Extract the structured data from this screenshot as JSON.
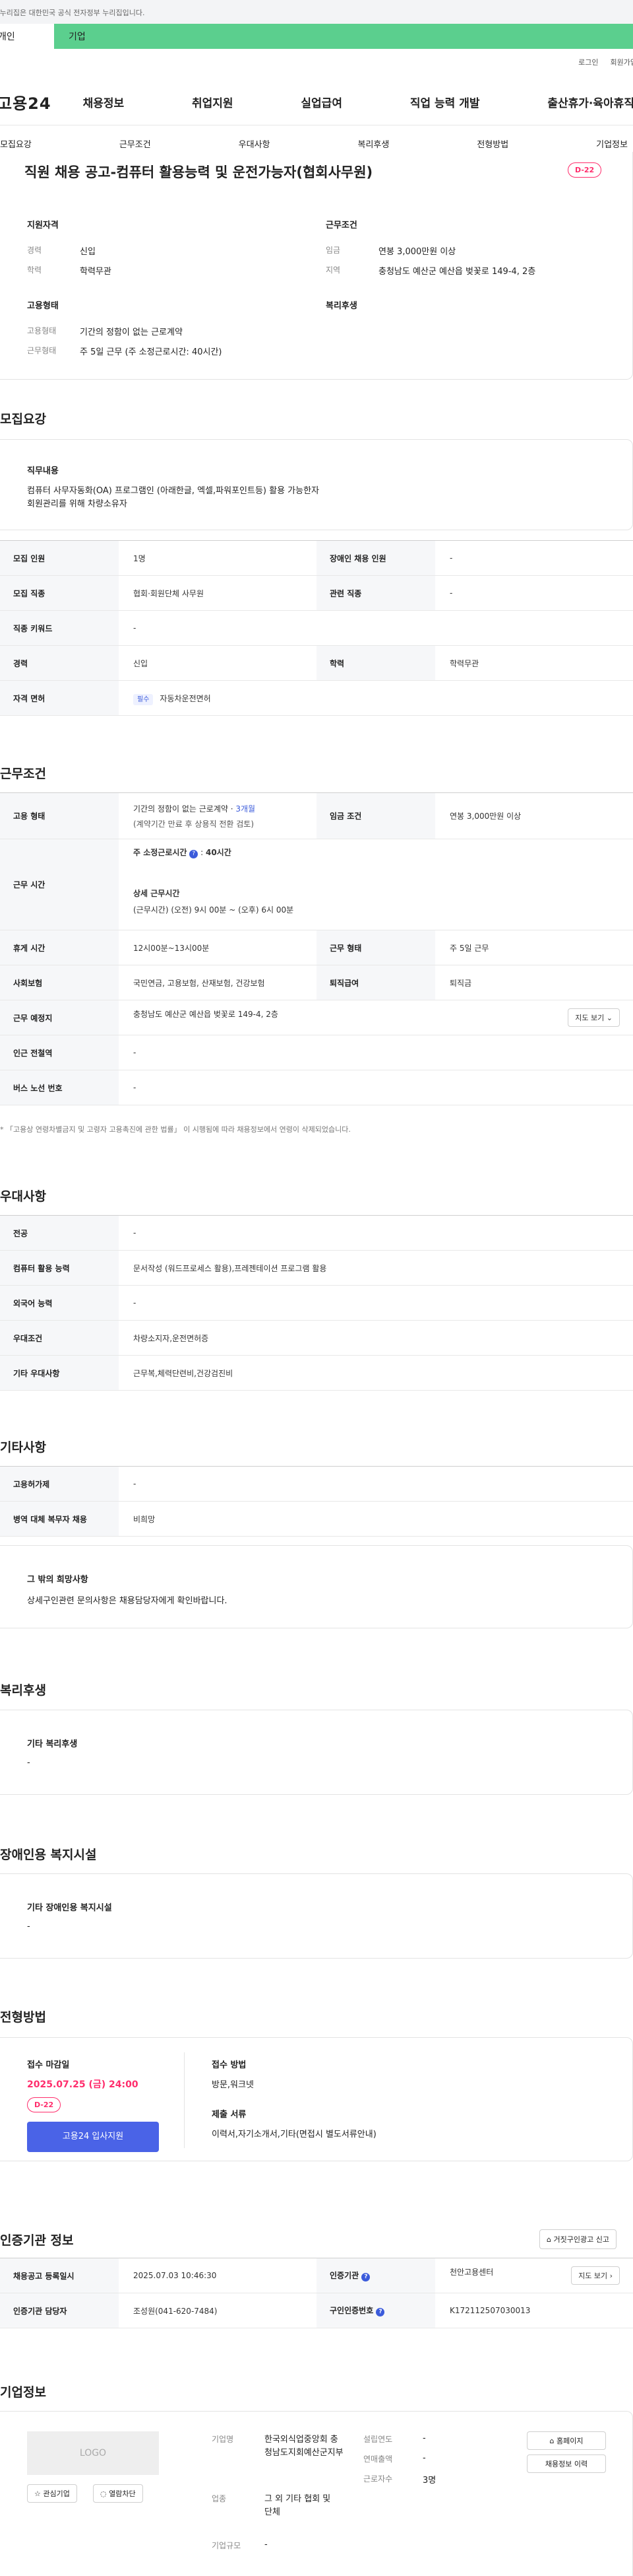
{
  "gov_banner": "이 누리집은 대한민국 공식 전자정부 누리집입니다.",
  "top_tabs": [
    "개인",
    "기업"
  ],
  "util": {
    "login": "로그인",
    "join": "회원가입"
  },
  "logo": "고용24",
  "gnb": [
    "채용정보",
    "취업지원",
    "실업급여",
    "직업 능력 개발",
    "출산휴가·육아휴직"
  ],
  "subtabs": [
    "모집요강",
    "근무조건",
    "우대사항",
    "복리후생",
    "전형방법",
    "기업정보"
  ],
  "summary": {
    "title": "직원 채용 공고-컴퓨터 활용능력 및 운전가능자(협회사무원)",
    "dday": "D-22",
    "qual_head": "지원자격",
    "cond_head": "근무조건",
    "form_head": "고용형태",
    "welfare_head": "복리후생",
    "career_lbl": "경력",
    "career": "신입",
    "edu_lbl": "학력",
    "edu": "학력무관",
    "wage_lbl": "임금",
    "wage": "연봉 3,000만원 이상",
    "area_lbl": "지역",
    "area": "충청남도 예산군 예산읍 벚꽃로 149-4, 2층",
    "type_lbl": "고용형태",
    "type": "기간의 정함이 없는 근로계약",
    "form_lbl": "근무형태",
    "form": "주 5일 근무 (주 소정근로시간: 40시간)"
  },
  "recruit": {
    "title": "모집요강",
    "duty_head": "직무내용",
    "duty_l1": "컴퓨터 사무자동화(OA) 프로그램인 (아래한글, 엑셀,파워포인트등) 활용 가능한자",
    "duty_l2": "회원관리를 위해 차량소유자",
    "rows": [
      {
        "k1": "모집 인원",
        "v1": "1명",
        "k2": "장애인 채용 인원",
        "v2": "-"
      },
      {
        "k1": "모집 직종",
        "v1": "협회·회원단체 사무원",
        "k2": "관련 직종",
        "v2": "-"
      },
      {
        "k1": "직종 키워드",
        "v1": "-"
      },
      {
        "k1": "경력",
        "v1": "신입",
        "k2": "학력",
        "v2": "학력무관"
      },
      {
        "k1": "자격 면허",
        "badge": "필수",
        "v1": "자동차운전면허"
      }
    ]
  },
  "work": {
    "title": "근무조건",
    "type_k": "고용 형태",
    "type_v": "기간의 정함이 없는 근로계약 · ",
    "type_v2": "3개월",
    "type_note": "(계약기간 만료 후 상용직 전환 검토)",
    "wage_k": "임금 조건",
    "wage_v": "연봉 3,000만원 이상",
    "time_k": "근무 시간",
    "time_std": "주 소정근로시간",
    "time_std_v": "40시간",
    "time_detail_h": "상세 근무시간",
    "time_detail": "(근무시간) (오전) 9시 00분 ~ (오후) 6시 00분",
    "rest_k": "휴게 시간",
    "rest_v": "12시00분~13시00분",
    "form_k": "근무 형태",
    "form_v": "주 5일 근무",
    "ins_k": "사회보험",
    "ins_v": "국민연금, 고용보험, 산재보험, 건강보험",
    "ret_k": "퇴직급여",
    "ret_v": "퇴직금",
    "loc_k": "근무 예정지",
    "loc_v": "충청남도 예산군 예산읍 벚꽃로 149-4, 2층",
    "map_btn": "지도 보기",
    "sub_k": "인근 전철역",
    "sub_v": "-",
    "bus_k": "버스 노선 번호",
    "bus_v": "-",
    "note": "* 「고용상 연령차별금지 및 고령자 고용촉진에 관한 법률」 이 시행됨에 따라 채용정보에서 연령이 삭제되었습니다."
  },
  "pref": {
    "title": "우대사항",
    "rows": [
      {
        "k": "전공",
        "v": "-"
      },
      {
        "k": "컴퓨터 활용 능력",
        "v": "문서작성 (워드프로세스 활용),프레젠테이션 프로그램 활용"
      },
      {
        "k": "외국어 능력",
        "v": "-"
      },
      {
        "k": "우대조건",
        "v": "차량소지자,운전면허증"
      },
      {
        "k": "기타 우대사항",
        "v": "근무복,체력단련비,건강검진비"
      }
    ]
  },
  "etc": {
    "title": "기타사항",
    "rows": [
      {
        "k": "고용허가제",
        "v": "-"
      },
      {
        "k": "병역 대체 복무자 채용",
        "v": "비희망"
      }
    ],
    "box_h": "그 밖의 희망사항",
    "box_v": "상세구인관련 문의사항은 채용담당자에게 확인바랍니다."
  },
  "welfare": {
    "title": "복리후생",
    "h": "기타 복리후생",
    "v": "-"
  },
  "disabled": {
    "title": "장애인용 복지시설",
    "h": "기타 장애인용 복지시설",
    "v": "-"
  },
  "selection": {
    "title": "전형방법",
    "deadline_h": "접수 마감일",
    "deadline": "2025.07.25 (금) 24:00",
    "dday": "D-22",
    "apply_btn": "고용24 입사지원",
    "method_h": "접수 방법",
    "method": "방문,워크넷",
    "docs_h": "제출 서류",
    "docs": "이력서,자기소개서,기타(면접시 별도서류안내)"
  },
  "agency": {
    "title": "인증기관 정보",
    "report_btn": "거짓구인광고 신고",
    "reg_k": "채용공고 등록일시",
    "reg_v": "2025.07.03 10:46:30",
    "ag_k": "인증기관",
    "ag_v": "천안고용센터",
    "map_btn": "지도 보기",
    "mgr_k": "인증기관 담당자",
    "mgr_v": "조성원(041-620-7484)",
    "no_k": "구인인증번호",
    "no_v": "K172112507030013"
  },
  "company": {
    "title": "기업정보",
    "logo": "LOGO",
    "fav_btn": "관심기업",
    "block_btn": "열람차단",
    "name_k": "기업명",
    "name_v": "한국외식업중앙회 충청남도지회예산군지부",
    "industry_k": "업종",
    "industry_v": "그 외 기타 협회 및 단체",
    "size_k": "기업규모",
    "size_v": "-",
    "year_k": "설립연도",
    "year_v": "-",
    "sales_k": "연매출액",
    "sales_v": "-",
    "emp_k": "근로자수",
    "emp_v": "3명",
    "home_btn": "홈페이지",
    "jobs_btn": "채용정보 이력"
  }
}
